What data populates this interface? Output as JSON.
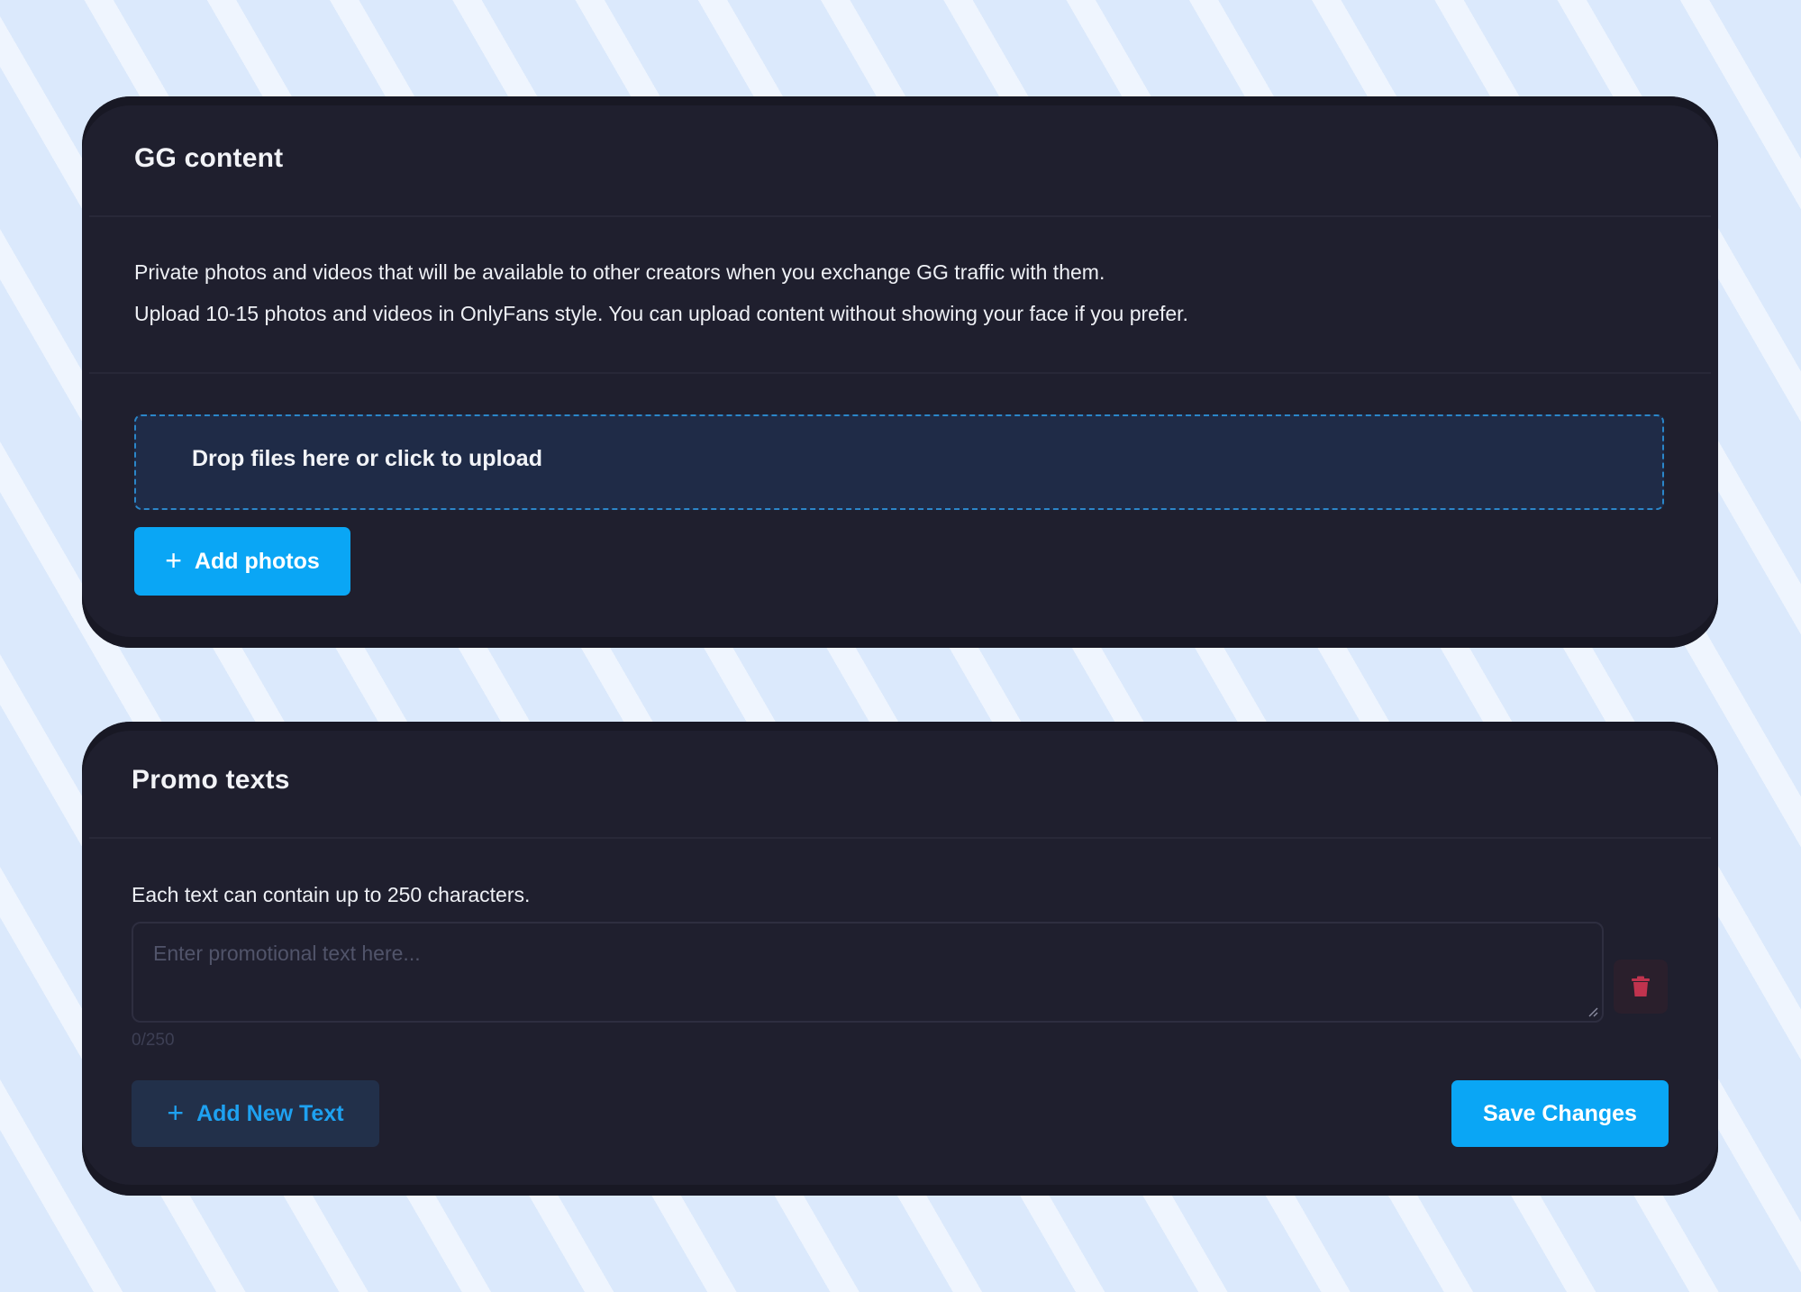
{
  "gg_content": {
    "title": "GG content",
    "description_lines": [
      "Private photos and videos that will be available to other creators when you exchange GG traffic with them.",
      "Upload 10-15 photos and videos in OnlyFans style. You can upload content without showing your face if you prefer."
    ],
    "dropzone_text": "Drop files here or click to upload",
    "add_photos_label": "Add photos",
    "plus_icon": "+"
  },
  "promo_texts": {
    "title": "Promo texts",
    "hint": "Each text can contain up to 250 characters.",
    "input_value": "",
    "input_placeholder": "Enter promotional text here...",
    "char_count": "0/250",
    "add_text_label": "Add New Text",
    "save_label": "Save Changes",
    "plus_icon": "+",
    "delete_icon": "trash-icon"
  },
  "colors": {
    "background": "#dbe9fc",
    "card": "#1f1f2e",
    "accent": "#0aa6f5",
    "dropzone_bg": "#1f2b47",
    "danger": "#c0334e"
  }
}
